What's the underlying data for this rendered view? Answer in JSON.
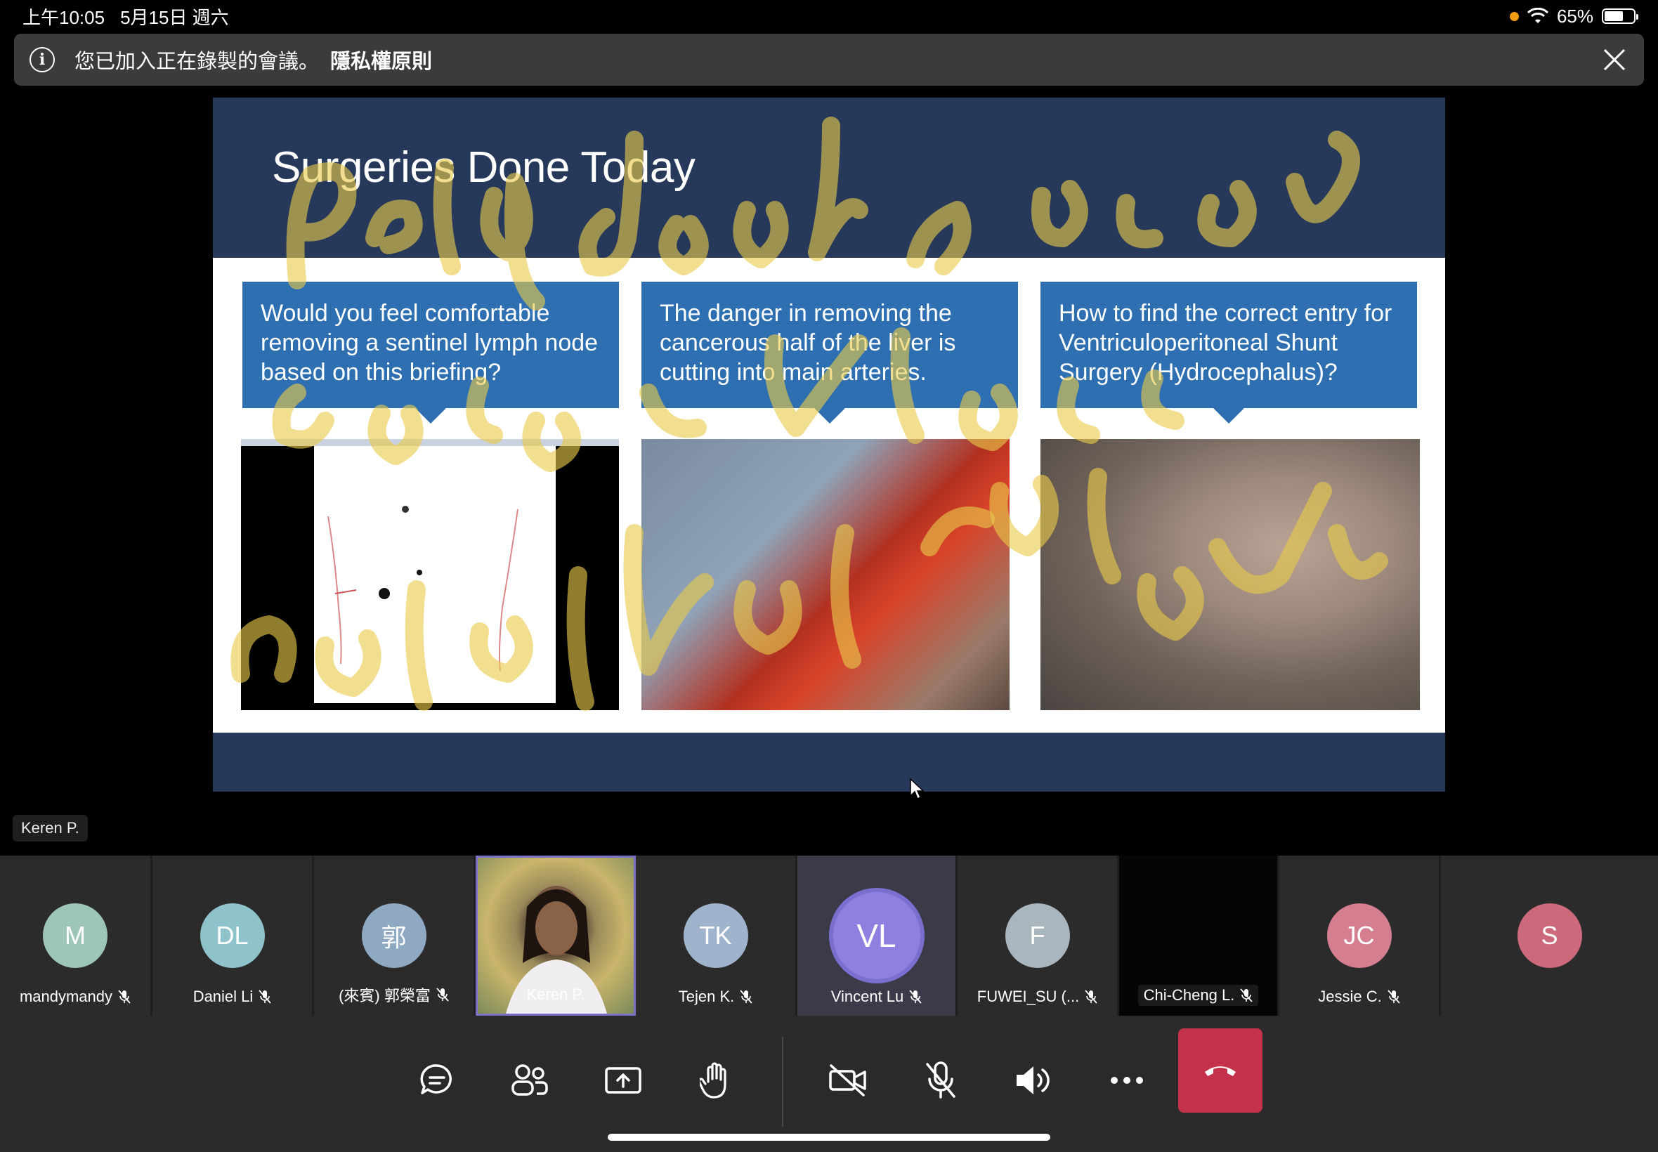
{
  "status_bar": {
    "time": "上午10:05",
    "date": "5月15日 週六",
    "battery": "65%"
  },
  "banner": {
    "message": "您已加入正在錄製的會議。",
    "link": "隱私權原則"
  },
  "slide": {
    "title": "Surgeries Done Today",
    "questions": [
      "Would you feel comfortable removing a sentinel lymph node based on this briefing?",
      "The danger in removing the cancerous half of the liver is cutting into main arteries.",
      "How to find the correct entry for Ventriculoperitoneal Shunt Surgery (Hydrocephalus)?"
    ]
  },
  "speaker_label": "Keren P.",
  "participants": [
    {
      "initials": "M",
      "name": "mandymandy",
      "color": "#9ec6b8"
    },
    {
      "initials": "DL",
      "name": "Daniel Li",
      "color": "#8fc3cc"
    },
    {
      "initials": "郭",
      "name": "(來賓) 郭榮富",
      "color": "#8fa9c2"
    },
    {
      "initials": "",
      "name": "Keren P.",
      "color": ""
    },
    {
      "initials": "TK",
      "name": "Tejen K.",
      "color": "#9fb4cc"
    },
    {
      "initials": "VL",
      "name": "Vincent Lu",
      "color": "#8f7fe0"
    },
    {
      "initials": "F",
      "name": "FUWEI_SU (...",
      "color": "#a9b6bd"
    },
    {
      "initials": "",
      "name": "Chi-Cheng L.",
      "color": ""
    },
    {
      "initials": "JC",
      "name": "Jessie C.",
      "color": "#d47e90"
    },
    {
      "initials": "S",
      "name": "",
      "color": "#cc6a7c"
    }
  ],
  "icons": {
    "chat": "chat-icon",
    "people": "people-icon",
    "share": "share-screen-icon",
    "raise_hand": "raise-hand-icon",
    "camera_off": "camera-off-icon",
    "mic_off": "mic-off-icon",
    "speaker": "speaker-icon",
    "more": "more-icon",
    "hang_up": "hang-up-icon"
  },
  "colors": {
    "hangup": "#c4314b",
    "slide_header": "#27395a",
    "slide_box": "#2d6fb0",
    "active_ring": "#7a6fd0"
  }
}
